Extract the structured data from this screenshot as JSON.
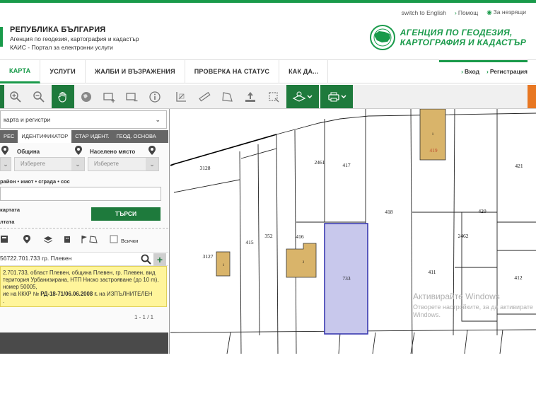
{
  "util": {
    "lang": "switch to English",
    "help": "Помощ",
    "accessibility": "За незрящи"
  },
  "brand": {
    "country": "РЕПУБЛИКА БЪЛГАРИЯ",
    "agency": "Агенция по геодезия, картография и кадастър",
    "portal": "КАИС - Портал за електронни услуги"
  },
  "agency_logo": {
    "line1": "АГЕНЦИЯ ПО ГЕОДЕЗИЯ,",
    "line2": "КАРТОГРАФИЯ И КАДАСТЪР"
  },
  "nav": {
    "items": [
      "КАРТА",
      "УСЛУГИ",
      "ЖАЛБИ И ВЪЗРАЖЕНИЯ",
      "ПРОВЕРКА НА СТАТУС",
      "КАК ДА..."
    ],
    "login": "Вход",
    "register": "Регистрация"
  },
  "panel": {
    "dropdown": "карта и регистри",
    "tabs": [
      "РЕС",
      "ИДЕНТИФИКАТОР",
      "СТАР ИДЕНТ.",
      "ГЕОД. ОСНОВА"
    ],
    "municipality_label": "Община",
    "settlement_label": "Населено място",
    "placeholder": "Изберете",
    "hint": "район • имот • сграда • сос",
    "map_label": "картата",
    "results_label": "лтата",
    "search_button": "ТЪРСИ",
    "all_label": "Всички",
    "result_id": "56722.701.733 гр. Плевен",
    "info_line1": "2.701.733, област Плевен, община Плевен, гр. Плевен, вид",
    "info_line2": "територия Урбанизирана, НТП Ниско застрояване (до 10 m),",
    "info_line3": "номер 50005,",
    "info_line4_pre": "ие на КККР № ",
    "info_line4_bold": "РД-18-71/06.06.2008 г.",
    "info_line4_post": " на ИЗПЪЛНИТЕЛЕН",
    "info_line5": ".",
    "pager": "1 - 1 / 1"
  },
  "map": {
    "labels": {
      "p3128": "3128",
      "p2461": "2461",
      "p417": "417",
      "p419": "419",
      "p421": "421",
      "p418": "418",
      "p420": "420",
      "p415": "415",
      "p352": "352",
      "p416": "416",
      "p2462": "2462",
      "p3127": "3127",
      "p733": "733",
      "p411": "411",
      "p412": "412",
      "b1a": "1",
      "b1b": "1",
      "b2": "2"
    },
    "selected_fill": "#c8c8ec",
    "selected_stroke": "#3a3ab0",
    "building_fill": "#d9b46a"
  },
  "watermark": {
    "title": "Активирайте Windows",
    "sub1": "Отворете настройките, за да активирате",
    "sub2": "Windows."
  },
  "colors": {
    "brand_green": "#199a4a",
    "dark_green": "#1e7a3c",
    "accent_orange": "#e87722"
  }
}
